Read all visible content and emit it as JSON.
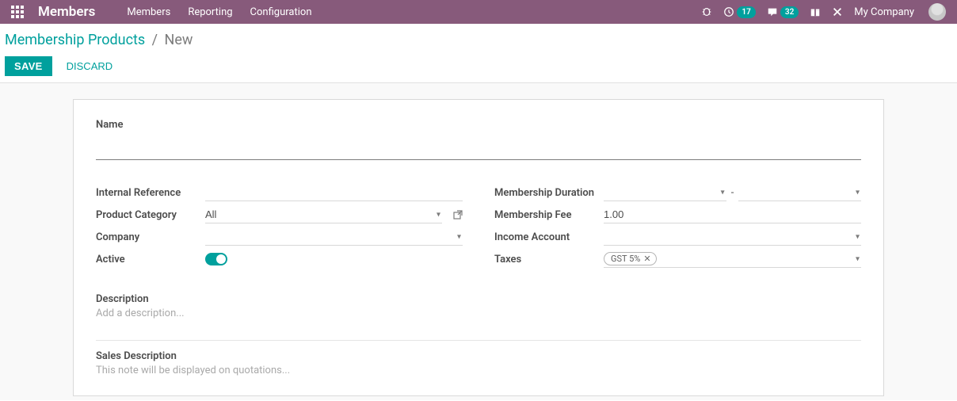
{
  "nav": {
    "brand": "Members",
    "links": [
      "Members",
      "Reporting",
      "Configuration"
    ],
    "activities_count": "17",
    "messages_count": "32",
    "company": "My Company"
  },
  "breadcrumb": {
    "parent": "Membership Products",
    "current": "New"
  },
  "buttons": {
    "save": "SAVE",
    "discard": "DISCARD"
  },
  "form": {
    "name_label": "Name",
    "name_value": "",
    "left": {
      "internal_reference": {
        "label": "Internal Reference",
        "value": ""
      },
      "product_category": {
        "label": "Product Category",
        "value": "All"
      },
      "company": {
        "label": "Company",
        "value": ""
      },
      "active": {
        "label": "Active"
      }
    },
    "right": {
      "membership_duration": {
        "label": "Membership Duration",
        "from": "",
        "to": ""
      },
      "membership_fee": {
        "label": "Membership Fee",
        "value": "1.00"
      },
      "income_account": {
        "label": "Income Account",
        "value": ""
      },
      "taxes": {
        "label": "Taxes",
        "tags": [
          "GST 5%"
        ]
      }
    },
    "description": {
      "label": "Description",
      "placeholder": "Add a description..."
    },
    "sales_description": {
      "label": "Sales Description",
      "placeholder": "This note will be displayed on quotations..."
    }
  }
}
